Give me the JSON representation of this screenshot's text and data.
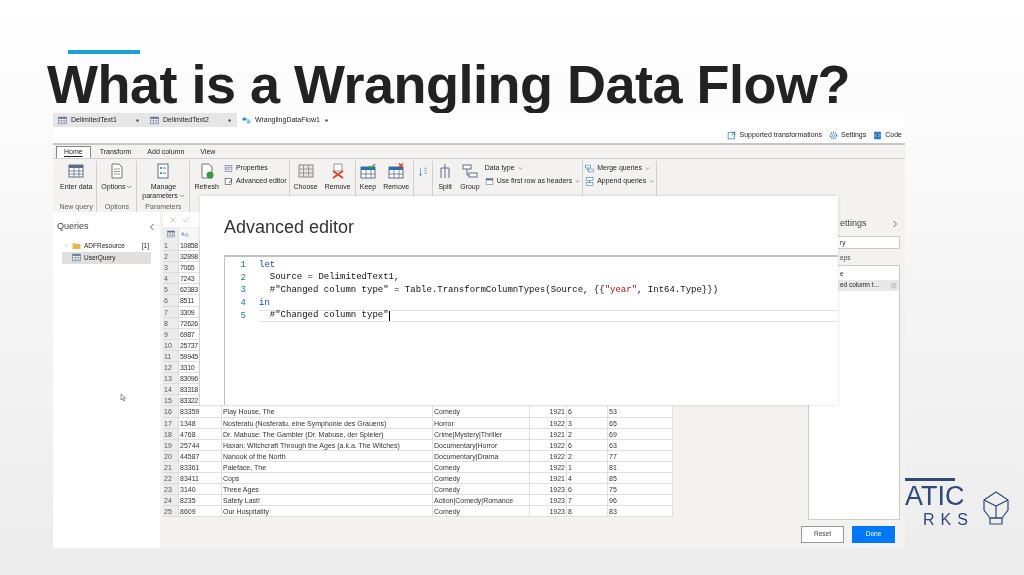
{
  "slide": {
    "title": "What is a Wrangling Data Flow?",
    "logo": {
      "line_1": "ATIC",
      "line_2": "RKS"
    }
  },
  "doc_tabs": [
    {
      "label": "DelimitedText1",
      "selected": false
    },
    {
      "label": "DelimitedText2",
      "selected": false
    },
    {
      "label": "WranglingDataFlow1",
      "selected": true
    }
  ],
  "commands": [
    {
      "label": "Supported transformations"
    },
    {
      "label": "Settings"
    },
    {
      "label": "Code"
    }
  ],
  "ribbon_tabs": [
    {
      "label": "Home",
      "selected": true
    },
    {
      "label": "Transform",
      "selected": false
    },
    {
      "label": "Add column",
      "selected": false
    },
    {
      "label": "View",
      "selected": false
    }
  ],
  "ribbon_groups": [
    {
      "label": "New query",
      "items": [
        {
          "kind": "large",
          "label": "Enter data",
          "dropdown": false
        }
      ]
    },
    {
      "label": "Options",
      "items": [
        {
          "kind": "large",
          "label": "Options",
          "dropdown": true
        }
      ]
    },
    {
      "label": "Parameters",
      "items": [
        {
          "kind": "large",
          "label": "Manage parameters",
          "dropdown": true
        }
      ]
    },
    {
      "items": [
        {
          "kind": "large",
          "label": "Refresh",
          "dropdown": false
        },
        {
          "kind": "small",
          "label": "Properties",
          "dropdown": false
        },
        {
          "kind": "small",
          "label": "Advanced editor",
          "dropdown": false
        }
      ]
    },
    {
      "items": [
        {
          "kind": "large",
          "label": "Choose",
          "dropdown": false
        },
        {
          "kind": "large",
          "label": "Remove",
          "dropdown": false
        }
      ]
    },
    {
      "items": [
        {
          "kind": "large",
          "label": "Keep",
          "dropdown": false
        },
        {
          "kind": "large",
          "label": "Remove",
          "dropdown": false
        }
      ]
    },
    {
      "items": [
        {
          "kind": "sort"
        }
      ]
    },
    {
      "items": [
        {
          "kind": "large",
          "label": "Split",
          "dropdown": false
        },
        {
          "kind": "large",
          "label": "Group",
          "dropdown": false
        },
        {
          "kind": "small",
          "label": "Data type",
          "dropdown": true
        },
        {
          "kind": "small",
          "label": "Use first row as headers",
          "dropdown": true
        }
      ]
    },
    {
      "items": [
        {
          "kind": "small",
          "label": "Merge queries",
          "dropdown": true
        },
        {
          "kind": "small",
          "label": "Append queries",
          "dropdown": true
        }
      ]
    }
  ],
  "queries": {
    "title": "Queries",
    "items": [
      {
        "kind": "folder",
        "label": "ADFResource",
        "count": "[1]",
        "selected": false
      },
      {
        "kind": "query",
        "label": "UserQuery",
        "selected": true
      }
    ]
  },
  "grid": {
    "rows": [
      {
        "index": "1",
        "cells": [
          "10858"
        ]
      },
      {
        "index": "2",
        "cells": [
          "32898"
        ]
      },
      {
        "index": "3",
        "cells": [
          "7065"
        ]
      },
      {
        "index": "4",
        "cells": [
          "7243"
        ]
      },
      {
        "index": "5",
        "cells": [
          "62383"
        ]
      },
      {
        "index": "6",
        "cells": [
          "8511"
        ]
      },
      {
        "index": "7",
        "cells": [
          "3309"
        ]
      },
      {
        "index": "8",
        "cells": [
          "72626"
        ]
      },
      {
        "index": "9",
        "cells": [
          "6987"
        ]
      },
      {
        "index": "10",
        "cells": [
          "25737"
        ]
      },
      {
        "index": "11",
        "cells": [
          "59945"
        ]
      },
      {
        "index": "12",
        "cells": [
          "3310"
        ]
      },
      {
        "index": "13",
        "cells": [
          "83096"
        ]
      },
      {
        "index": "14",
        "cells": [
          "83318"
        ]
      },
      {
        "index": "15",
        "cells": [
          "83322"
        ]
      },
      {
        "index": "16",
        "cells": [
          "83359",
          "Play House, The",
          "Comedy",
          "1921",
          "6",
          "53"
        ]
      },
      {
        "index": "17",
        "cells": [
          "1348",
          "Nosferatu (Nosferatu, eine Symphonie des Grauens)",
          "Horror",
          "1922",
          "3",
          "65"
        ]
      },
      {
        "index": "18",
        "cells": [
          "4768",
          "Dr. Mabuse: The Gambler (Dr. Mabuse, der Spieler)",
          "Crime|Mystery|Thriller",
          "1921",
          "2",
          "69"
        ]
      },
      {
        "index": "19",
        "cells": [
          "25744",
          "Haxan: Witchcraft Through the Ages (a.k.a. The Witches)",
          "Documentary|Horror",
          "1922",
          "6",
          "63"
        ]
      },
      {
        "index": "20",
        "cells": [
          "44587",
          "Nanook of the North",
          "Documentary|Drama",
          "1922",
          "2",
          "77"
        ]
      },
      {
        "index": "21",
        "cells": [
          "83361",
          "Paleface, The",
          "Comedy",
          "1922",
          "1",
          "81"
        ]
      },
      {
        "index": "22",
        "cells": [
          "83411",
          "Cops",
          "Comedy",
          "1921",
          "4",
          "85"
        ]
      },
      {
        "index": "23",
        "cells": [
          "3140",
          "Three Ages",
          "Comedy",
          "1923",
          "6",
          "75"
        ]
      },
      {
        "index": "24",
        "cells": [
          "8235",
          "Safety Last!",
          "Action|Comedy|Romance",
          "1923",
          "7",
          "96"
        ]
      },
      {
        "index": "25",
        "cells": [
          "8609",
          "Our Hospitality",
          "Comedy",
          "1923",
          "8",
          "83"
        ]
      }
    ]
  },
  "settings_panel": {
    "title": "ettings",
    "query_name": "ry",
    "steps_label": "eps",
    "steps": [
      {
        "label": "e",
        "selected": false
      },
      {
        "label": "ed column t...",
        "selected": true
      }
    ]
  },
  "advanced_editor": {
    "title": "Advanced editor",
    "lines": [
      {
        "number": "1",
        "current": false,
        "tokens": [
          {
            "kind": "keyword",
            "text": "let"
          }
        ]
      },
      {
        "number": "2",
        "current": false,
        "tokens": [
          {
            "kind": "plain",
            "text": "  Source = DelimitedText1,"
          }
        ]
      },
      {
        "number": "3",
        "current": false,
        "tokens": [
          {
            "kind": "plain",
            "text": "  #\"Changed column type\" = Table.TransformColumnTypes(Source, {{"
          },
          {
            "kind": "string",
            "text": "\"year\""
          },
          {
            "kind": "plain",
            "text": ", Int64.Type}})"
          }
        ]
      },
      {
        "number": "4",
        "current": false,
        "tokens": [
          {
            "kind": "keyword",
            "text": "in"
          }
        ]
      },
      {
        "number": "5",
        "current": true,
        "tokens": [
          {
            "kind": "plain",
            "text": "  #\"Changed column type\""
          }
        ]
      }
    ]
  },
  "dialog_buttons": [
    {
      "label": "Reset",
      "primary": false
    },
    {
      "label": "Done",
      "primary": true
    }
  ]
}
